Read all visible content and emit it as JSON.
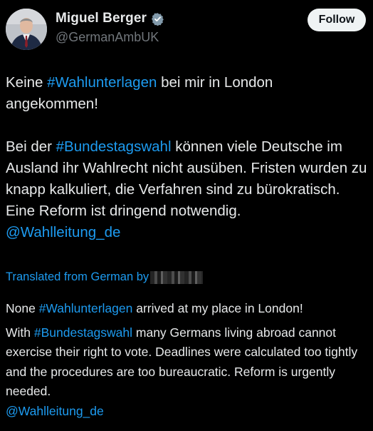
{
  "author": {
    "display_name": "Miguel Berger",
    "handle": "@GermanAmbUK",
    "verified": true
  },
  "follow_label": "Follow",
  "original": {
    "p1": [
      {
        "t": "text",
        "v": "Keine "
      },
      {
        "t": "link",
        "v": "#Wahlunterlagen"
      },
      {
        "t": "text",
        "v": " bei mir in London angekommen!"
      }
    ],
    "p2": [
      {
        "t": "text",
        "v": "Bei der "
      },
      {
        "t": "link",
        "v": "#Bundestagswahl"
      },
      {
        "t": "text",
        "v": " können viele Deutsche im Ausland ihr Wahlrecht nicht ausüben. Fristen wurden zu knapp kalkuliert, die Verfahren sind zu bürokratisch. Eine Reform ist dringend notwendig."
      }
    ],
    "mention": "@Wahlleitung_de"
  },
  "translated_label": "Translated from German by",
  "translation": {
    "p1": [
      {
        "t": "text",
        "v": "None "
      },
      {
        "t": "link",
        "v": "#Wahlunterlagen"
      },
      {
        "t": "text",
        "v": " arrived at my place in London!"
      }
    ],
    "p2": [
      {
        "t": "text",
        "v": "With "
      },
      {
        "t": "link",
        "v": "#Bundestagswahl"
      },
      {
        "t": "text",
        "v": " many Germans living abroad cannot exercise their right to vote. Deadlines were calculated too tightly and the procedures are too bureaucratic. Reform is urgently needed."
      }
    ],
    "mention": "@Wahlleitung_de"
  },
  "colors": {
    "background": "#000000",
    "text": "#e7e9ea",
    "secondary": "#71767b",
    "link": "#1d9bf0",
    "follow_bg": "#eff3f4"
  }
}
